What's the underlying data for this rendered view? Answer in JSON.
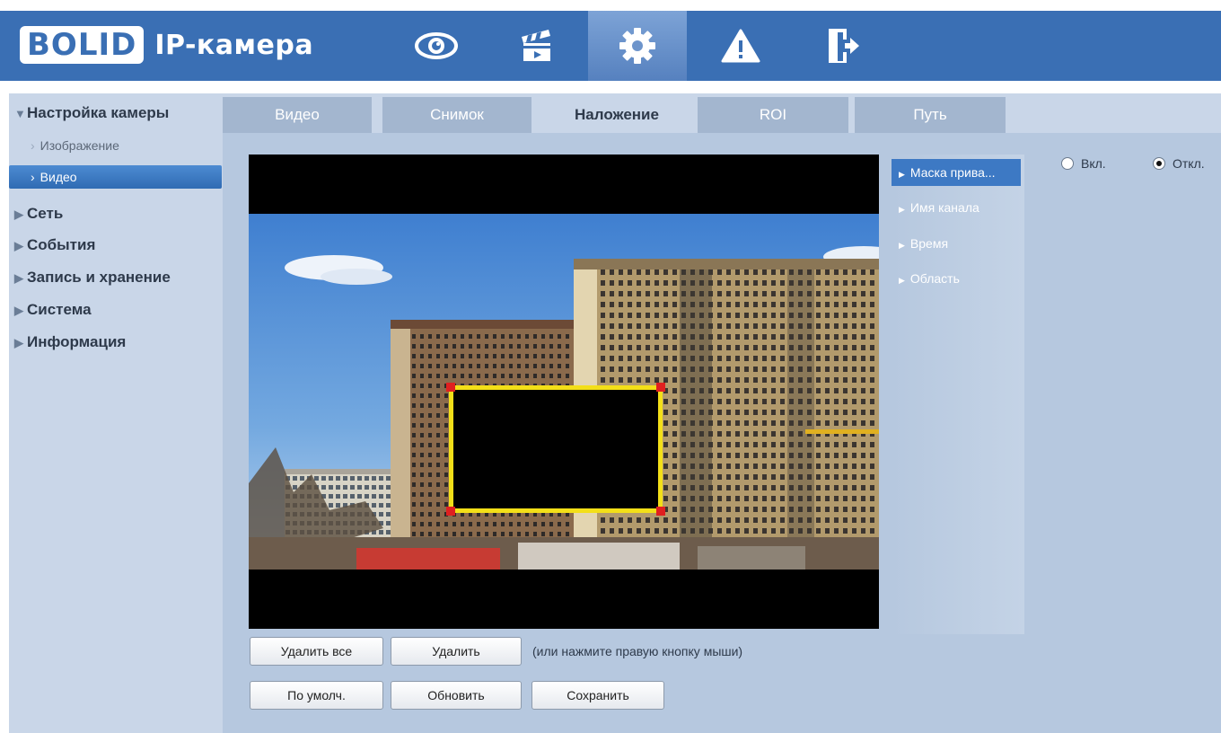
{
  "header": {
    "logo_text": "BOLID",
    "title": "IP-камера",
    "nav": [
      {
        "icon": "eye-icon",
        "label": "live-view"
      },
      {
        "icon": "clapperboard-icon",
        "label": "playback"
      },
      {
        "icon": "gear-icon",
        "label": "setup",
        "active": true
      },
      {
        "icon": "warning-icon",
        "label": "alarm"
      },
      {
        "icon": "logout-icon",
        "label": "logout"
      }
    ]
  },
  "sidebar": {
    "section_camera": "Настройка камеры",
    "sub_image": "Изображение",
    "sub_video": "Видео",
    "network": "Сеть",
    "events": "События",
    "storage": "Запись и хранение",
    "system": "Система",
    "info": "Информация",
    "expanded_marker": "▼",
    "collapsed_marker": "▶",
    "sub_chevron": "›"
  },
  "tabs": {
    "video": "Видео",
    "snapshot": "Снимок",
    "overlay": "Наложение",
    "roi": "ROI",
    "path": "Путь"
  },
  "buttons": {
    "delete_all": "Удалить все",
    "delete": "Удалить",
    "hint": "(или нажмите правую кнопку мыши)",
    "default": "По умолч.",
    "refresh": "Обновить",
    "save": "Сохранить"
  },
  "submenu": {
    "privacy_mask": "Маска прива...",
    "channel_name": "Имя канала",
    "time": "Время",
    "region": "Область",
    "arrow": "▶"
  },
  "privacy_mask": {
    "on_label": "Вкл.",
    "off_label": "Откл.",
    "selected": "off"
  },
  "colors": {
    "header_bg": "#3a6fb4",
    "panel_bg": "#c9d6e8",
    "content_bg": "#b6c8df",
    "tab_inactive": "#a3b6cf",
    "active_blue": "#3d79c4",
    "mask_border": "#f3df18",
    "mask_handle": "#e02020"
  }
}
